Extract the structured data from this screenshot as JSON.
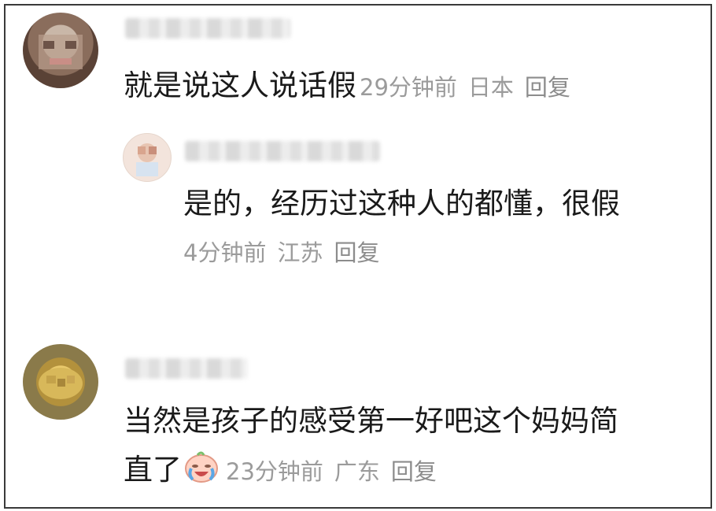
{
  "comments": [
    {
      "text": "就是说这人说话假",
      "time": "29分钟前",
      "location": "日本",
      "reply_label": "回复"
    },
    {
      "text": "是的，经历过这种人的都懂，很假",
      "time": "4分钟前",
      "location": "江苏",
      "reply_label": "回复"
    },
    {
      "text_line1": "当然是孩子的感受第一好吧这个妈妈简",
      "text_line2": "直了",
      "emoji": "crying-laughing-face-icon",
      "time": "23分钟前",
      "location": "广东",
      "reply_label": "回复"
    }
  ],
  "colors": {
    "border": "#3a3a3a",
    "text": "#1a1a1a",
    "meta": "#9b9b9b"
  }
}
